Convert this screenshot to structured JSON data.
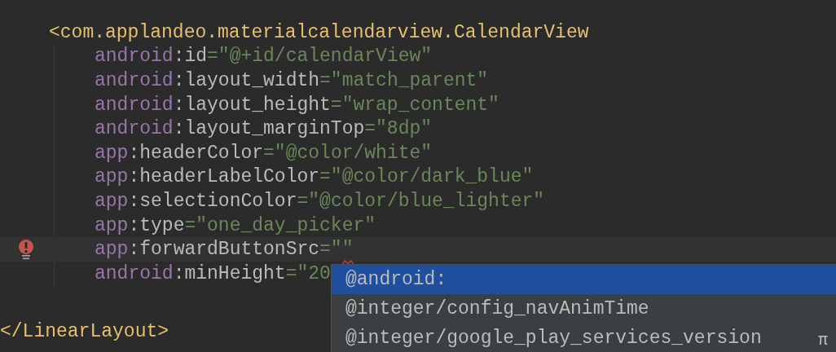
{
  "editor": {
    "lines": [
      {
        "kind": "open_tag",
        "current": false,
        "error": false,
        "tokens": [
          {
            "kind": "tag",
            "text": "<com.applandeo.materialcalendarview.CalendarView"
          }
        ]
      },
      {
        "kind": "attribute",
        "current": false,
        "error": false,
        "tokens": [
          {
            "kind": "namespace",
            "text": "android"
          },
          {
            "kind": "name",
            "text": ":id"
          },
          {
            "kind": "value",
            "text": "=\"@+id/calendarView\""
          }
        ]
      },
      {
        "kind": "attribute",
        "current": false,
        "error": false,
        "tokens": [
          {
            "kind": "namespace",
            "text": "android"
          },
          {
            "kind": "name",
            "text": ":layout_width"
          },
          {
            "kind": "value",
            "text": "=\"match_parent\""
          }
        ]
      },
      {
        "kind": "attribute",
        "current": false,
        "error": false,
        "tokens": [
          {
            "kind": "namespace",
            "text": "android"
          },
          {
            "kind": "name",
            "text": ":layout_height"
          },
          {
            "kind": "value",
            "text": "=\"wrap_content\""
          }
        ]
      },
      {
        "kind": "attribute",
        "current": false,
        "error": false,
        "tokens": [
          {
            "kind": "namespace",
            "text": "android"
          },
          {
            "kind": "name",
            "text": ":layout_marginTop"
          },
          {
            "kind": "value",
            "text": "=\"8dp\""
          }
        ]
      },
      {
        "kind": "attribute",
        "current": false,
        "error": false,
        "tokens": [
          {
            "kind": "namespace",
            "text": "app"
          },
          {
            "kind": "name",
            "text": ":headerColor"
          },
          {
            "kind": "value",
            "text": "=\"@color/white\""
          }
        ]
      },
      {
        "kind": "attribute",
        "current": false,
        "error": false,
        "tokens": [
          {
            "kind": "namespace",
            "text": "app"
          },
          {
            "kind": "name",
            "text": ":headerLabelColor"
          },
          {
            "kind": "value",
            "text": "=\"@color/dark_blue\""
          }
        ]
      },
      {
        "kind": "attribute",
        "current": false,
        "error": false,
        "tokens": [
          {
            "kind": "namespace",
            "text": "app"
          },
          {
            "kind": "name",
            "text": ":selectionColor"
          },
          {
            "kind": "value",
            "text": "=\"@color/blue_lighter\""
          }
        ]
      },
      {
        "kind": "attribute",
        "current": false,
        "error": false,
        "tokens": [
          {
            "kind": "namespace",
            "text": "app"
          },
          {
            "kind": "name",
            "text": ":type"
          },
          {
            "kind": "value",
            "text": "=\"one_day_picker\""
          }
        ]
      },
      {
        "kind": "attribute",
        "current": true,
        "error": true,
        "tokens": [
          {
            "kind": "namespace",
            "text": "app"
          },
          {
            "kind": "name",
            "text": ":forwardButtonSrc"
          },
          {
            "kind": "value",
            "text": "=\"\""
          }
        ]
      },
      {
        "kind": "attribute",
        "current": false,
        "error": false,
        "tokens": [
          {
            "kind": "namespace",
            "text": "android"
          },
          {
            "kind": "name",
            "text": ":minHeight"
          },
          {
            "kind": "value",
            "text": "=\"20"
          }
        ]
      },
      {
        "kind": "close_tag",
        "current": false,
        "error": false,
        "tokens": [
          {
            "kind": "tag",
            "text": "</LinearLayout>"
          }
        ]
      }
    ]
  },
  "completion_popup": {
    "items": [
      {
        "text": "@android:",
        "selected": true
      },
      {
        "text": "@integer/config_navAnimTime",
        "selected": false
      },
      {
        "text": "@integer/google_play_services_version",
        "selected": false
      }
    ],
    "hint": "π"
  }
}
